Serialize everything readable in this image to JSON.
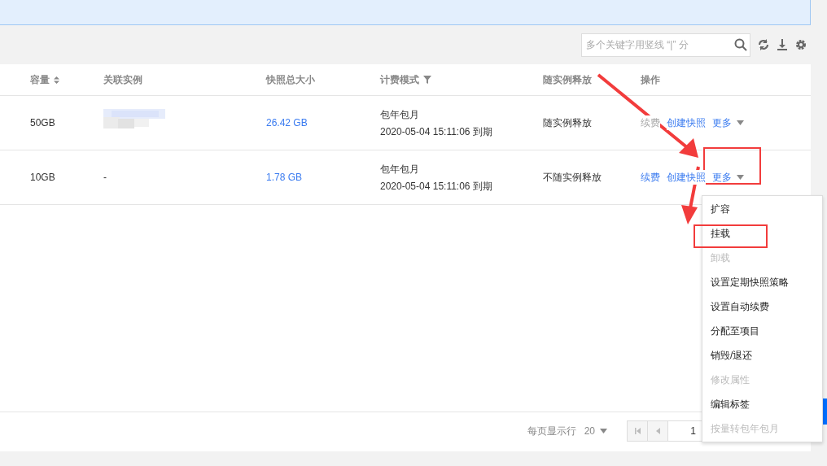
{
  "search": {
    "placeholder": "多个关键字用竖线 “|” 分"
  },
  "table": {
    "columns": [
      {
        "label": "容量",
        "sort": true,
        "filter": false
      },
      {
        "label": "关联实例",
        "sort": false,
        "filter": false
      },
      {
        "label": "快照总大小",
        "sort": false,
        "filter": false
      },
      {
        "label": "计费模式",
        "sort": false,
        "filter": true
      },
      {
        "label": "随实例释放",
        "sort": false,
        "filter": false
      },
      {
        "label": "操作",
        "sort": false,
        "filter": false
      }
    ],
    "rows": [
      {
        "capacity": "50GB",
        "snapshot_size": "26.42 GB",
        "billing": "包年包月",
        "expiry": "2020-05-04 15:11:06 到期",
        "release": "随实例释放",
        "actions": [
          {
            "label": "续费",
            "disabled": true
          },
          {
            "label": "创建快照",
            "disabled": false
          }
        ],
        "more": "更多"
      },
      {
        "capacity": "10GB",
        "instance": {
          "kind": "text",
          "text": "-"
        },
        "snapshot_size": "1.78 GB",
        "billing": "包年包月",
        "expiry": "2020-05-04 15:11:06 到期",
        "release": "不随实例释放",
        "actions": [
          {
            "label": "续费",
            "disabled": false
          },
          {
            "label": "创建快照",
            "disabled": false
          }
        ],
        "more": "更多"
      }
    ]
  },
  "menu": [
    {
      "label": "扩容",
      "disabled": false
    },
    {
      "label": "挂载",
      "disabled": false
    },
    {
      "label": "卸载",
      "disabled": true
    },
    {
      "label": "设置定期快照策略",
      "disabled": false
    },
    {
      "label": "设置自动续费",
      "disabled": false
    },
    {
      "label": "分配至项目",
      "disabled": false
    },
    {
      "label": "销毁/退还",
      "disabled": false
    },
    {
      "label": "修改属性",
      "disabled": true
    },
    {
      "label": "编辑标签",
      "disabled": false
    },
    {
      "label": "按量转包年包月",
      "disabled": true
    }
  ],
  "pagination": {
    "rows_label": "每页显示行",
    "page_size": "20",
    "page": "1"
  }
}
